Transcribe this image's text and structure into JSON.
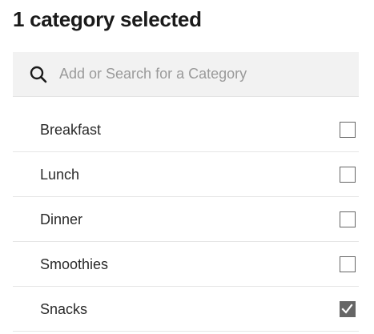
{
  "header": {
    "title": "1 category selected"
  },
  "search": {
    "placeholder": "Add or Search for a Category",
    "value": "",
    "icon": "search-icon"
  },
  "categories": [
    {
      "label": "Breakfast",
      "checked": false
    },
    {
      "label": "Lunch",
      "checked": false
    },
    {
      "label": "Dinner",
      "checked": false
    },
    {
      "label": "Smoothies",
      "checked": false
    },
    {
      "label": "Snacks",
      "checked": true
    }
  ],
  "colors": {
    "checkbox_checked_fill": "#666666",
    "search_background": "#f2f2f2"
  }
}
